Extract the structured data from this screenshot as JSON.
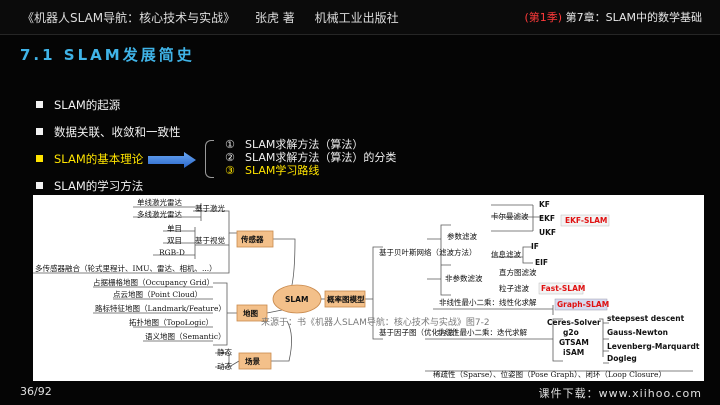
{
  "header": {
    "book_title": "《机器人SLAM导航：核心技术与实战》",
    "author": "张虎 著",
    "publisher": "机械工业出版社",
    "season": "(第1季)",
    "chapter": "第7章：SLAM中的数学基础"
  },
  "page_title": "7.1 SLAM发展简史",
  "bullets": [
    "SLAM的起源",
    "数据关联、收敛和一致性",
    "SLAM的基本理论",
    "SLAM的学习方法"
  ],
  "subitems": [
    {
      "num": "①",
      "text": "SLAM求解方法（算法）"
    },
    {
      "num": "②",
      "text": "SLAM求解方法（算法）的分类"
    },
    {
      "num": "③",
      "text": "SLAM学习路线"
    }
  ],
  "mindmap": {
    "center": "SLAM",
    "left": {
      "sensor": "传感器",
      "laser_group": "基于激光",
      "single_laser": "单线激光雷达",
      "multi_laser": "多线激光雷达",
      "vision_group": "基于视觉",
      "mono": "单目",
      "stereo": "双目",
      "rgbd": "RGB-D",
      "fusion": "多传感器融合（轮式里程计、IMU、雷达、相机、...）",
      "map": "地图",
      "map_items": [
        "占据栅格地图（Occupancy Grid）",
        "点云地图（Point Cloud）",
        "路标特征地图（Landmark/Feature）",
        "拓扑地图（TopoLogic）",
        "语义地图（Semantic）"
      ],
      "scene": "场景",
      "static": "静态",
      "dynamic": "动态"
    },
    "right": {
      "prob_model": "概率图模型",
      "bayes": "基于贝叶斯网络（滤波方法）",
      "param_filter": "参数滤波",
      "kalman": "卡尔曼滤波",
      "kf": "KF",
      "ekf": "EKF",
      "ekf_slam": "EKF-SLAM",
      "ukf": "UKF",
      "info_filter": "信息滤波",
      "if": "IF",
      "eif": "EIF",
      "nonparam": "非参数滤波",
      "histogram": "直方图滤波",
      "particle": "粒子滤波",
      "fastslam": "Fast-SLAM",
      "nonlinear_linear": "非线性最小二乘：线性化求解",
      "graph_slam": "Graph-SLAM",
      "factor": "基于因子图（优化方法）",
      "nonlinear_iter": "非线性最小二乘：迭代求解",
      "solvers": [
        "Ceres-Solver",
        "g2o",
        "GTSAM",
        "iSAM"
      ],
      "methods": [
        "steepsest descent",
        "Gauss-Newton",
        "Levenberg-Marquardt",
        "Dogleg"
      ],
      "sparse": "稀疏性（Sparse）、位姿图（Pose Graph）、闭环（Loop Closure）"
    },
    "watermark": "来源于：书《机器人SLAM导航：核心技术与实战》图7-2"
  },
  "footer": {
    "page": "36/92",
    "download": "课件下载：www.xiihoo.com"
  },
  "colors": {
    "accent_title": "#40b4e8",
    "highlight": "#ffe400",
    "season_red": "#ff3a3a",
    "arrow_blue": "#3a7fe0",
    "node_orange": "#f3c08a",
    "red_label": "#e01010"
  }
}
